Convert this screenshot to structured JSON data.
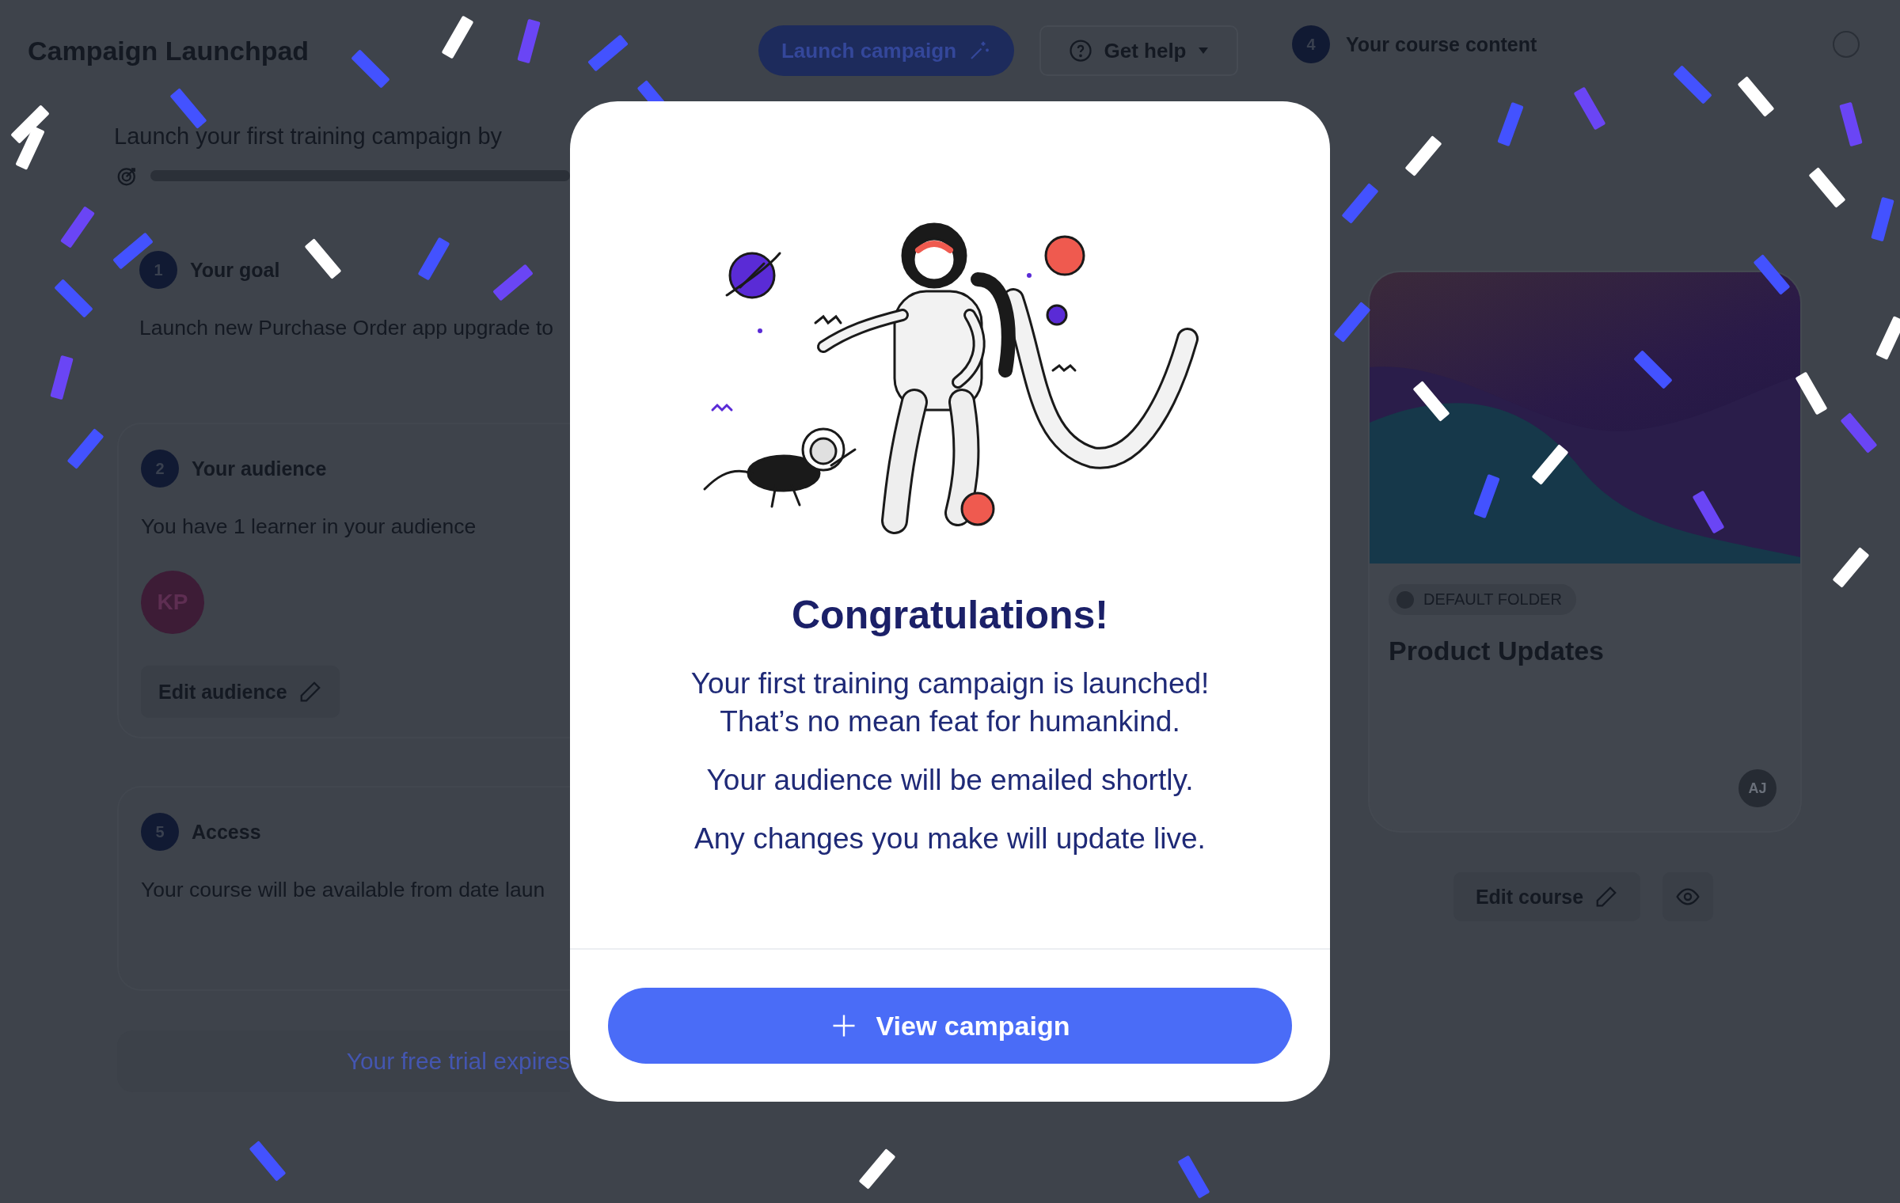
{
  "header": {
    "title": "Campaign Launchpad",
    "launch_button": "Launch campaign",
    "help_button": "Get help"
  },
  "intro": {
    "text": "Launch your first training campaign by"
  },
  "steps": [
    {
      "number": "1",
      "title": "Your goal",
      "text": "Launch new Purchase Order app upgrade to"
    },
    {
      "number": "2",
      "title": "Your audience",
      "text": "You have 1 learner in your audience",
      "avatar": "KP",
      "button": "Edit audience"
    },
    {
      "number": "5",
      "title": "Access",
      "text": "Your course will be available from date laun"
    }
  ],
  "trial_banner": "Your free trial expires",
  "content": {
    "number": "4",
    "title": "Your course content",
    "course": {
      "folder": "DEFAULT FOLDER",
      "title": "Product Updates",
      "avatar": "AJ"
    },
    "edit_button": "Edit course"
  },
  "modal": {
    "title": "Congratulations!",
    "paragraphs": [
      "Your first training campaign is launched!\nThat’s no mean feat for humankind.",
      "Your audience will be emailed shortly.",
      "Any changes you make will update live."
    ],
    "button": "View campaign"
  }
}
